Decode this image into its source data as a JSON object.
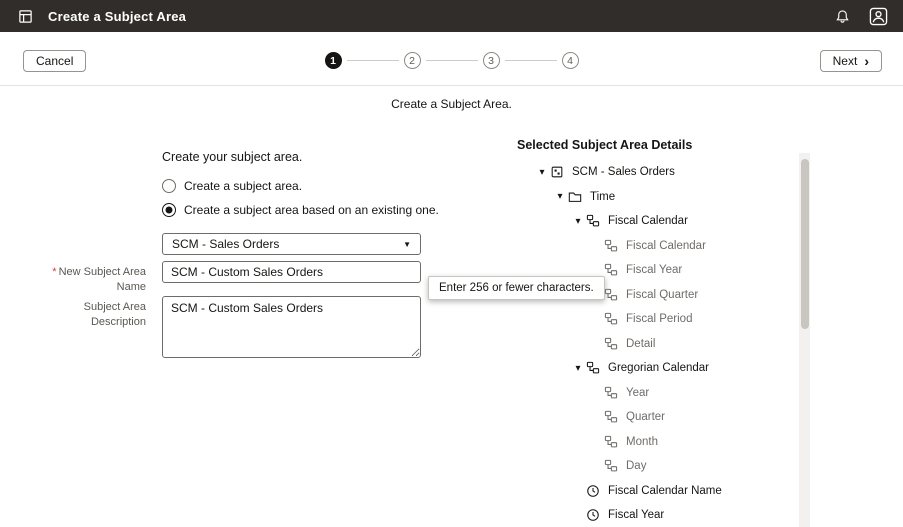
{
  "icons": {
    "caret_down": "▾",
    "select_caret": "▼",
    "next_chevron": "›"
  },
  "header": {
    "title": "Create a Subject Area"
  },
  "wizard": {
    "cancel_label": "Cancel",
    "next_label": "Next",
    "subtitle": "Create a Subject Area.",
    "steps": [
      {
        "number": "1",
        "active": true
      },
      {
        "number": "2",
        "active": false
      },
      {
        "number": "3",
        "active": false
      },
      {
        "number": "4",
        "active": false
      }
    ]
  },
  "form": {
    "section_title": "Create your subject area.",
    "radios": [
      {
        "label": "Create a subject area.",
        "selected": false
      },
      {
        "label": "Create a subject area based on an existing one.",
        "selected": true
      }
    ],
    "source_select": {
      "value": "SCM - Sales Orders"
    },
    "name_field": {
      "label": "New Subject Area Name",
      "required_marker": "*",
      "value": "SCM - Custom Sales Orders"
    },
    "tooltip": "Enter 256 or fewer characters.",
    "description_field": {
      "label": "Subject Area Description",
      "value": "SCM - Custom Sales Orders"
    }
  },
  "details": {
    "title": "Selected Subject Area Details",
    "tree": [
      {
        "label": "SCM - Sales Orders",
        "icon": "subject-area-icon",
        "level": 0,
        "caret": true,
        "tone": "dark"
      },
      {
        "label": "Time",
        "icon": "folder-icon",
        "level": 1,
        "caret": true,
        "tone": "dark"
      },
      {
        "label": "Fiscal Calendar",
        "icon": "hierarchy-icon",
        "level": 2,
        "caret": true,
        "tone": "dark"
      },
      {
        "label": "Fiscal Calendar",
        "icon": "level-icon",
        "level": 3,
        "caret": false,
        "tone": "gray"
      },
      {
        "label": "Fiscal Year",
        "icon": "level-icon",
        "level": 3,
        "caret": false,
        "tone": "gray"
      },
      {
        "label": "Fiscal Quarter",
        "icon": "level-icon",
        "level": 3,
        "caret": false,
        "tone": "gray"
      },
      {
        "label": "Fiscal Period",
        "icon": "level-icon",
        "level": 3,
        "caret": false,
        "tone": "gray"
      },
      {
        "label": "Detail",
        "icon": "level-icon",
        "level": 3,
        "caret": false,
        "tone": "gray"
      },
      {
        "label": "Gregorian Calendar",
        "icon": "hierarchy-icon",
        "level": 2,
        "caret": true,
        "tone": "dark"
      },
      {
        "label": "Year",
        "icon": "level-icon",
        "level": 3,
        "caret": false,
        "tone": "gray"
      },
      {
        "label": "Quarter",
        "icon": "level-icon",
        "level": 3,
        "caret": false,
        "tone": "gray"
      },
      {
        "label": "Month",
        "icon": "level-icon",
        "level": 3,
        "caret": false,
        "tone": "gray"
      },
      {
        "label": "Day",
        "icon": "level-icon",
        "level": 3,
        "caret": false,
        "tone": "gray"
      },
      {
        "label": "Fiscal Calendar Name",
        "icon": "clock-icon",
        "level": 2,
        "caret": false,
        "tone": "dark"
      },
      {
        "label": "Fiscal Year",
        "icon": "clock-icon",
        "level": 2,
        "caret": false,
        "tone": "dark"
      }
    ]
  }
}
